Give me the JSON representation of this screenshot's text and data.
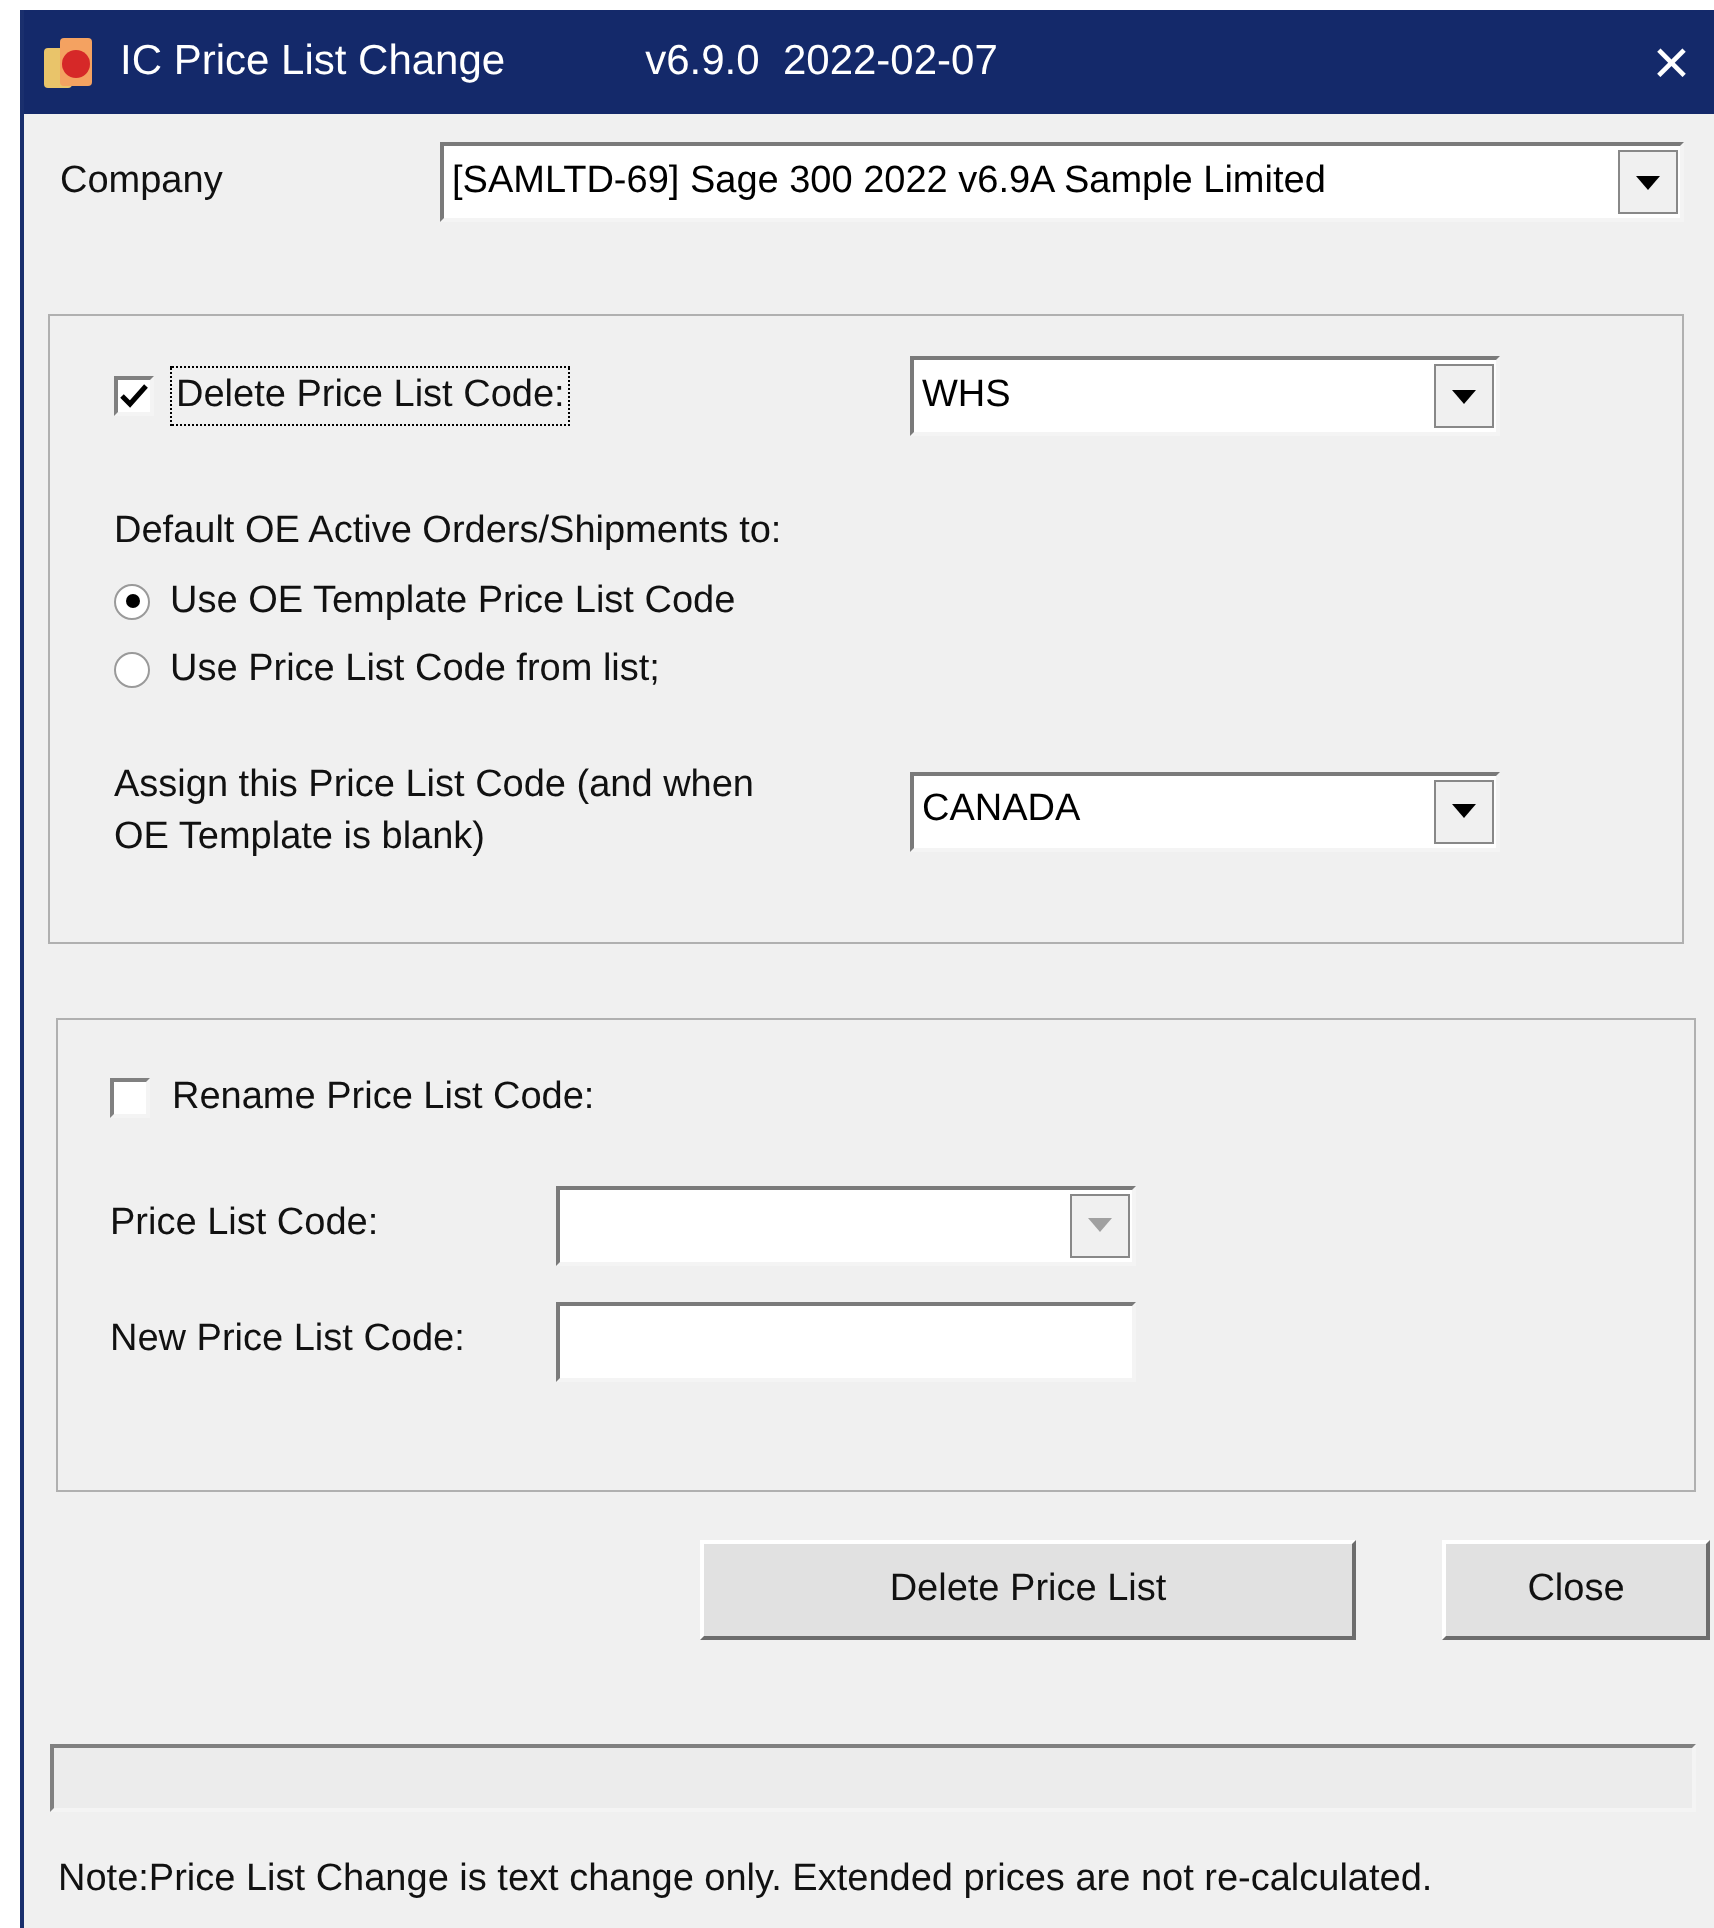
{
  "window": {
    "title": "IC Price List Change",
    "version": "v6.9.0  2022-02-07",
    "close_glyph": "×"
  },
  "company": {
    "label": "Company",
    "value": "[SAMLTD-69] Sage 300 2022 v6.9A Sample Limited",
    "disabled": false
  },
  "delete_group": {
    "checkbox": {
      "label": "Delete Price List Code:",
      "checked": true
    },
    "code": {
      "value": "WHS",
      "disabled": false
    },
    "default_label": "Default OE Active Orders/Shipments to:",
    "radios": [
      {
        "label": "Use OE Template Price List Code",
        "selected": true
      },
      {
        "label": "Use Price List Code from list;",
        "selected": false
      }
    ],
    "assign_label": "Assign this Price List Code (and when OE Template is blank)",
    "assign": {
      "value": "CANADA",
      "disabled": false
    }
  },
  "rename_group": {
    "checkbox": {
      "label": "Rename Price List Code:",
      "checked": false
    },
    "code_label": "Price List Code:",
    "code": {
      "disabled": true
    },
    "new_label": "New Price List Code:"
  },
  "buttons": [
    {
      "label": "Delete Price List",
      "kind": "primary"
    },
    {
      "label": "Close",
      "kind": "secondary"
    }
  ],
  "note": "Note:Price List Change is text change only. Extended prices are not re-calculated."
}
